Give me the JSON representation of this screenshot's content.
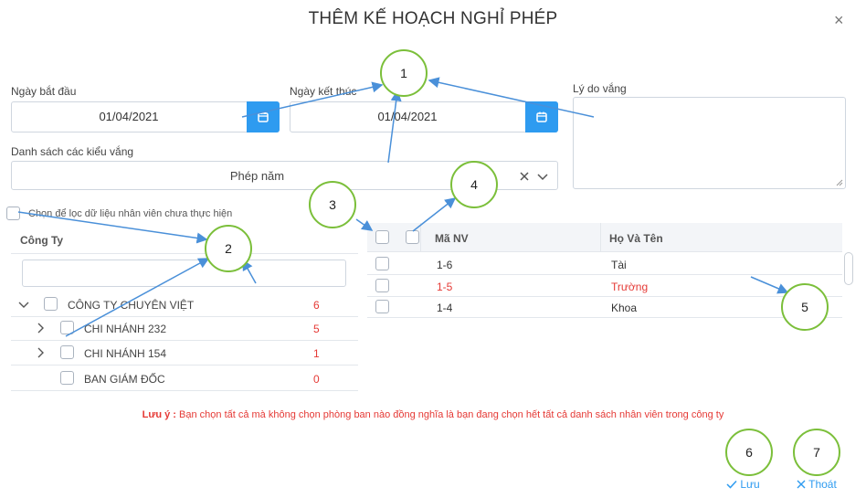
{
  "dialog": {
    "title": "THÊM KẾ HOẠCH NGHỈ PHÉP",
    "close_symbol": "×"
  },
  "form": {
    "start_date_label": "Ngày bắt đầu",
    "start_date_value": "01/04/2021",
    "end_date_label": "Ngày kết thúc",
    "end_date_value": "01/04/2021",
    "reason_label": "Lý do vắng",
    "reason_value": "",
    "absence_types_label": "Danh sách các kiểu vắng",
    "absence_type_value": "Phép năm",
    "filter_checkbox_label": "Chọn để lọc dữ liệu nhân viên chưa thực hiện"
  },
  "company_tree": {
    "header": "Công Ty",
    "search_value": "",
    "nodes": [
      {
        "label": "CÔNG TY CHUYÊN VIỆT",
        "count": "6"
      },
      {
        "label": "CHI NHÁNH 232",
        "count": "5"
      },
      {
        "label": "CHI NHÁNH 154",
        "count": "1"
      },
      {
        "label": "BAN GIÁM ĐỐC",
        "count": "0"
      }
    ]
  },
  "employee_table": {
    "columns": [
      "Mã NV",
      "Họ Và Tên"
    ],
    "rows": [
      {
        "code": "1-6",
        "name": "Tài",
        "highlight": false
      },
      {
        "code": "1-5",
        "name": "Trường",
        "highlight": true
      },
      {
        "code": "1-4",
        "name": "Khoa",
        "highlight": false
      }
    ]
  },
  "note": {
    "prefix": "Lưu ý :",
    "text": " Bạn chọn tất cả mà không chọn phòng ban nào đồng nghĩa là bạn đang chọn hết tất cả danh sách nhân viên trong công ty"
  },
  "footer": {
    "save_label": "Lưu",
    "exit_label": "Thoát"
  },
  "callouts": [
    "1",
    "2",
    "3",
    "4",
    "5",
    "6",
    "7"
  ],
  "icons": {
    "calendar": "calendar-icon",
    "clear": "clear-icon",
    "chevron_down": "chevron-down-icon",
    "chevron_right": "chevron-right-icon",
    "check": "check-icon",
    "close": "close-icon"
  },
  "colors": {
    "accent": "#2e9bf0",
    "warning": "#e53935",
    "callout_border": "#7bbf3a",
    "arrow": "#4a90d9"
  }
}
